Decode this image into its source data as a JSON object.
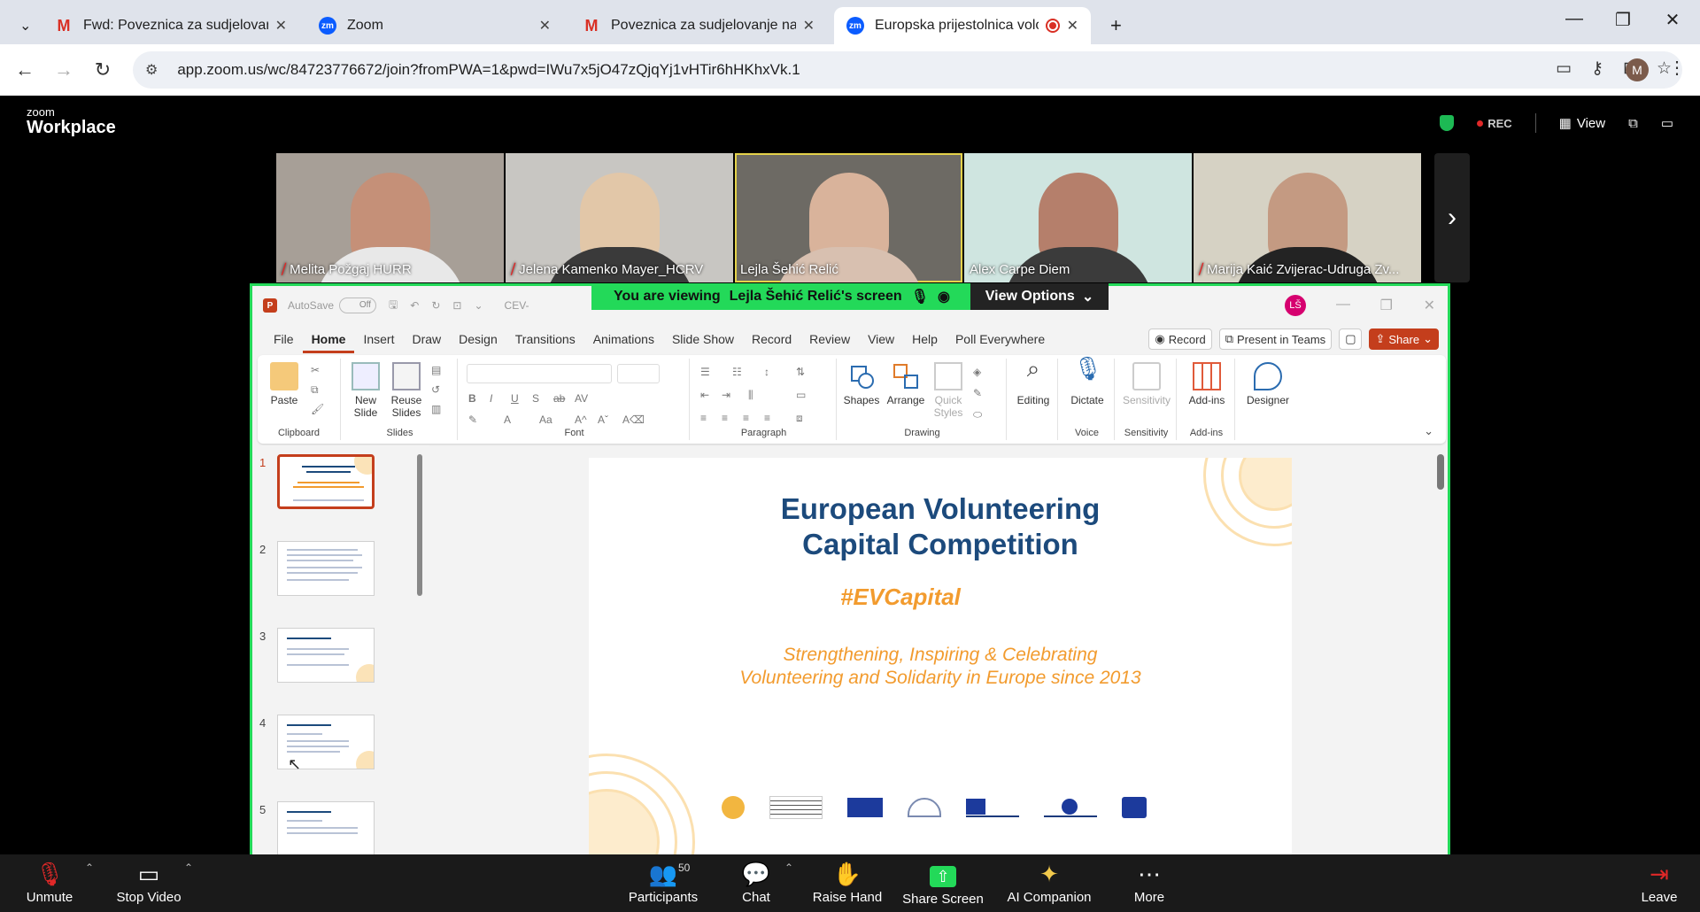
{
  "browser": {
    "tabs": [
      {
        "title": "Fwd: Poveznica za sudjelovanje",
        "icon": "gmail-icon"
      },
      {
        "title": "Zoom",
        "icon": "zoom-icon"
      },
      {
        "title": "Poveznica za sudjelovanje na w",
        "icon": "gmail-icon"
      },
      {
        "title": "Europska prijestolnica volon",
        "icon": "zoom-icon",
        "active": true
      }
    ],
    "url": "app.zoom.us/wc/84723776672/join?fromPWA=1&pwd=IWu7x5jO47zQjqYj1vHTir6hHKhxVk.1",
    "profile_initial": "M"
  },
  "zoom": {
    "logo_small": "zoom",
    "logo_big": "Workplace",
    "rec_label": "REC",
    "view_label": "View",
    "participants": [
      {
        "name": "Melita Požgaj HURR",
        "muted": true
      },
      {
        "name": "Jelena Kamenko Mayer_HCRV",
        "muted": true
      },
      {
        "name": "Lejla Šehić Relić",
        "muted": false
      },
      {
        "name": "Alex Carpe Diem",
        "muted": false
      },
      {
        "name": "Marija Kaić Zvijerac-Udruga Zv...",
        "muted": true
      }
    ],
    "banner_prefix": "You are viewing",
    "banner_name": "Lejla Šehić Relić's screen",
    "view_options": "View Options",
    "toolbar": {
      "unmute": "Unmute",
      "stop_video": "Stop Video",
      "participants": "Participants",
      "participants_count": "50",
      "chat": "Chat",
      "raise_hand": "Raise Hand",
      "share_screen": "Share Screen",
      "ai_companion": "AI Companion",
      "more": "More",
      "leave": "Leave"
    }
  },
  "ppt": {
    "autosave": "AutoSave",
    "autosave_state": "Off",
    "doc_name": "CEV-",
    "user_initials": "LŠ",
    "menu": [
      "File",
      "Home",
      "Insert",
      "Draw",
      "Design",
      "Transitions",
      "Animations",
      "Slide Show",
      "Record",
      "Review",
      "View",
      "Help",
      "Poll Everywhere"
    ],
    "record_btn": "Record",
    "present_teams": "Present in Teams",
    "share_btn": "Share",
    "ribbon": {
      "paste": "Paste",
      "clipboard": "Clipboard",
      "new_slide": "New Slide",
      "reuse_slides": "Reuse Slides",
      "slides": "Slides",
      "font": "Font",
      "paragraph": "Paragraph",
      "shapes": "Shapes",
      "arrange": "Arrange",
      "quick_styles": "Quick Styles",
      "drawing": "Drawing",
      "editing": "Editing",
      "dictate": "Dictate",
      "voice": "Voice",
      "sensitivity": "Sensitivity",
      "sensitivity_group": "Sensitivity",
      "addins": "Add-ins",
      "addins_group": "Add-ins",
      "designer": "Designer"
    },
    "thumb_numbers": [
      "1",
      "2",
      "3",
      "4",
      "5"
    ],
    "slide": {
      "title_line1": "European Volunteering",
      "title_line2": "Capital Competition",
      "hashtag": "#EVCapital",
      "subtitle_line1": "Strengthening, Inspiring & Celebrating",
      "subtitle_line2": "Volunteering and Solidarity in Europe since 2013"
    }
  }
}
